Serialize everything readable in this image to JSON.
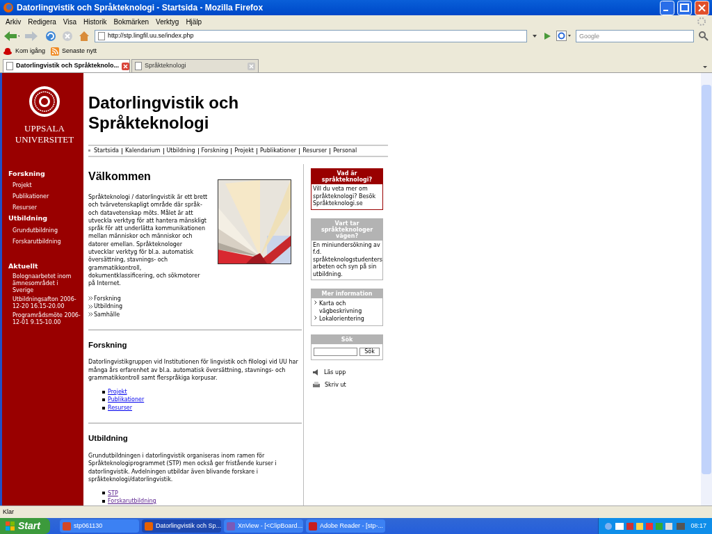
{
  "window": {
    "title": "Datorlingvistik och Språkteknologi - Startsida - Mozilla Firefox"
  },
  "menu": [
    "Arkiv",
    "Redigera",
    "Visa",
    "Historik",
    "Bokmärken",
    "Verktyg",
    "Hjälp"
  ],
  "toolbar": {
    "url": "http://stp.lingfil.uu.se/index.php",
    "search_placeholder": "Google"
  },
  "bookmarks": [
    {
      "kind": "redhat",
      "label": "Kom igång"
    },
    {
      "kind": "rss",
      "label": "Senaste nytt"
    }
  ],
  "tabs": [
    {
      "label": "Datorlingvistik och Språkteknolo...",
      "selected": true
    },
    {
      "label": "Språkteknologi",
      "selected": false
    }
  ],
  "page": {
    "logo": [
      "UPPSALA",
      "UNIVERSITET"
    ],
    "sidebar": [
      {
        "heading": "Forskning",
        "items": [
          "Projekt",
          "Publikationer",
          "Resurser"
        ]
      },
      {
        "heading": "Utbildning",
        "items": [
          "Grundutbildning",
          "Forskarutbildning"
        ]
      }
    ],
    "news": {
      "heading": "Aktuellt",
      "items": [
        "Bolognaarbetet inom ämnesområdet i Sverige",
        "Utbildningsafton 2006-12-20 16.15-20.00",
        "Programrådsmöte 2006-12-01 9.15-10.00"
      ]
    },
    "title": "Datorlingvistik och Språkteknologi",
    "nav": [
      "Startsida",
      "Kalendarium",
      "Utbildning",
      "Forskning",
      "Projekt",
      "Publikationer",
      "Resurser",
      "Personal"
    ],
    "welcome": {
      "heading": "Välkommen",
      "text": "Språkteknologi / datorlingvistik är ett brett och tvärvetenskapligt område där språk- och datavetenskap möts. Målet är att utveckla verktyg för att hantera mänskligt språk för att underlätta kommunikationen mellan människor och människor och datorer emellan. Språkteknologer utvecklar verktyg för bl.a. automatisk översättning, stavnings- och grammatikkontroll, dokumentklassificering, och sökmotorer på Internet.",
      "links": [
        "Forskning",
        "Utbildning",
        "Samhälle"
      ]
    },
    "sections": [
      {
        "heading": "Forskning",
        "text": "Datorlingvistikgruppen vid Institutionen för lingvistik och filologi vid UU har många års erfarenhet av bl.a. automatisk översättning, stavnings- och grammatikkontroll samt flerspråkiga korpusar.",
        "links": [
          {
            "label": "Projekt",
            "visited": false
          },
          {
            "label": "Publikationer",
            "visited": false
          },
          {
            "label": "Resurser",
            "visited": false
          }
        ]
      },
      {
        "heading": "Utbildning",
        "text": "Grundutbildningen i datorlingvistik organiseras inom ramen för Språkteknologiprogrammet (STP) men också ger fristående kurser i datorlingvistik. Avdelningen utbildar även blivande forskare i språkteknologi/datorlingvistik.",
        "links": [
          {
            "label": "STP",
            "visited": true
          },
          {
            "label": "Forskarutbildning",
            "visited": true
          }
        ]
      }
    ],
    "boxes": [
      {
        "kind": "text",
        "color": "#990000",
        "heading": "Vad är språkteknologi?",
        "text": "Vill du veta mer om språkteknologi? Besök Språkteknologi.se"
      },
      {
        "kind": "text",
        "color": "#b3b3b3",
        "heading": "Vart tar språkteknologer vägen?",
        "text": "En miniundersökning av f.d. språkteknologstudenters arbeten och syn på sin utbildning."
      },
      {
        "kind": "links",
        "color": "#b3b3b3",
        "heading": "Mer information",
        "items": [
          "Karta och vägbeskrivning",
          "Lokalorientering"
        ]
      },
      {
        "kind": "search",
        "color": "#b3b3b3",
        "heading": "Sök",
        "button": "Sök"
      }
    ],
    "tools": [
      {
        "kind": "speaker",
        "label": "Läs upp"
      },
      {
        "kind": "printer",
        "label": "Skriv ut"
      }
    ]
  },
  "status_bar": "Klar",
  "taskbar": {
    "start": "Start",
    "tasks": [
      {
        "kind": "ppt",
        "label": "stp061130",
        "selected": false
      },
      {
        "kind": "firefox",
        "label": "Datorlingvistik och Sp...",
        "selected": true
      },
      {
        "kind": "xnview",
        "label": "XnView - [<ClipBoard...",
        "selected": false
      },
      {
        "kind": "pdf",
        "label": "Adobe Reader - [stp-...",
        "selected": false
      }
    ],
    "clock": "08:17"
  }
}
